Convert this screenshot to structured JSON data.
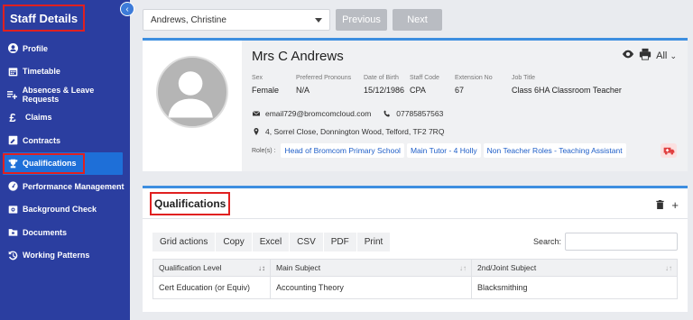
{
  "sidebar": {
    "title": "Staff Details",
    "items": [
      {
        "label": "Profile",
        "icon": "person-circle-icon"
      },
      {
        "label": "Timetable",
        "icon": "calendar-icon"
      },
      {
        "label": "Absences & Leave Requests",
        "icon": "list-plus-icon"
      },
      {
        "label": "Claims",
        "icon": "pound-icon"
      },
      {
        "label": "Contracts",
        "icon": "contract-icon"
      },
      {
        "label": "Qualifications",
        "icon": "trophy-icon"
      },
      {
        "label": "Performance Management",
        "icon": "gauge-icon"
      },
      {
        "label": "Background Check",
        "icon": "id-card-icon"
      },
      {
        "label": "Documents",
        "icon": "folder-icon"
      },
      {
        "label": "Working Patterns",
        "icon": "history-icon"
      }
    ],
    "active_index": 5
  },
  "topbar": {
    "selected_staff": "Andrews, Christine",
    "previous_label": "Previous",
    "next_label": "Next"
  },
  "staff": {
    "name": "Mrs C Andrews",
    "view_filter": "All",
    "fields": [
      {
        "key": "Sex",
        "value": "Female"
      },
      {
        "key": "Preferred Pronouns",
        "value": "N/A"
      },
      {
        "key": "Date of Birth",
        "value": "15/12/1986"
      },
      {
        "key": "Staff Code",
        "value": "CPA"
      },
      {
        "key": "Extension No",
        "value": "67"
      },
      {
        "key": "Job Title",
        "value": "Class 6HA Classroom Teacher"
      }
    ],
    "email": "email729@bromcomcloud.com",
    "phone": "07785857563",
    "address": "4, Sorrel Close, Donnington Wood, Telford, TF2 7RQ",
    "roles_label": "Role(s) :",
    "roles": [
      "Head of Bromcom Primary School",
      "Main Tutor - 4 Holly",
      "Non Teacher Roles - Teaching Assistant"
    ]
  },
  "qualifications": {
    "title": "Qualifications",
    "toolbar": [
      "Grid actions",
      "Copy",
      "Excel",
      "CSV",
      "PDF",
      "Print"
    ],
    "search_label": "Search:",
    "columns": [
      "Qualification Level",
      "Main Subject",
      "2nd/Joint Subject"
    ],
    "rows": [
      [
        "Cert Education (or Equiv)",
        "Accounting Theory",
        "Blacksmithing"
      ]
    ]
  },
  "colors": {
    "sidebar_bg": "#2b3ea0",
    "active_item": "#1e6fd8",
    "highlight_border": "#e02020",
    "accent": "#3d8ee0",
    "role_link": "#1e5ec8"
  }
}
